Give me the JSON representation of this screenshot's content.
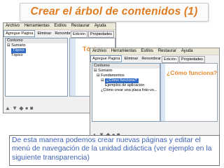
{
  "title": "Crear el árbol de contenidos (1)",
  "window1": {
    "menu": [
      "Archivo",
      "Herramientas",
      "Estilos",
      "Restaurar",
      "Ayuda"
    ],
    "toolbar": [
      "Agregue Pagina",
      "Eliminar",
      "Renombrar"
    ],
    "right_tabs": [
      "Edición",
      "Propiedades"
    ],
    "tree": [
      "Contorno",
      "Sumario",
      "Tópico",
      "Tópico"
    ],
    "pane_title": "Tópico"
  },
  "window2": {
    "menu": [
      "Archivo",
      "Herramientas",
      "Estilos",
      "Restaurar",
      "Ayuda"
    ],
    "toolbar": [
      "Agregue Pagina",
      "Eliminar",
      "Renombrar"
    ],
    "right_tabs": [
      "Edición",
      "Propiedades"
    ],
    "tree": [
      "Contorno",
      "Sumario",
      "Fundamentos",
      "¿Cómo funciona?",
      "Ejemplos de aplicación",
      "¿Cómo crear una placa foto-vo..."
    ],
    "pane_title": "¿Cómo funciona?"
  },
  "caption": "De esta manera podemos crear nuevas páginas y editar el menú de navegación de la unidad didáctica (ver ejemplo en la siguiente  transparencia)",
  "colors": {
    "title": "#e07a1f",
    "caption": "#3f63b8",
    "selection": "#316ac5"
  }
}
